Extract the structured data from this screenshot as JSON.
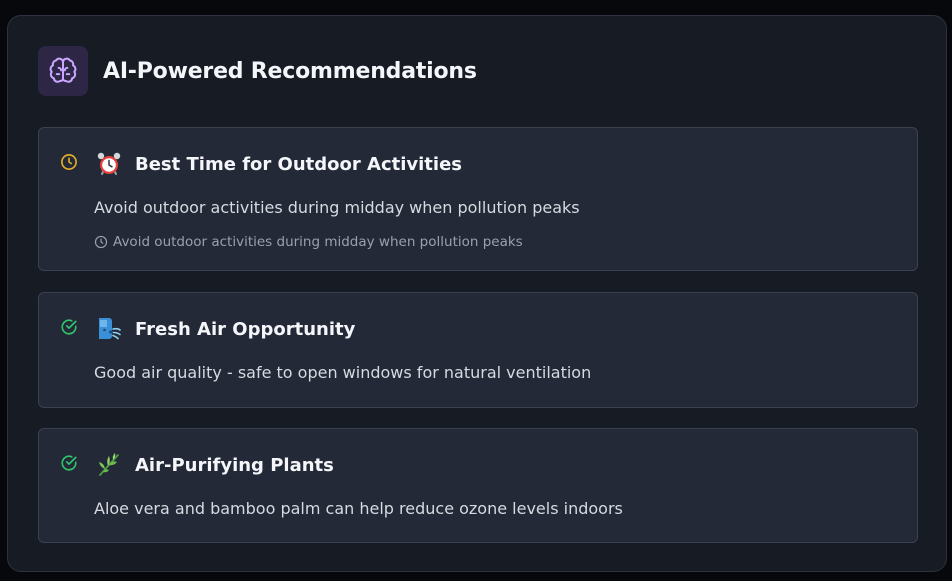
{
  "header": {
    "title": "AI-Powered Recommendations",
    "icon": "brain-icon",
    "icon_color": "#c9a6ff"
  },
  "recommendations": [
    {
      "status_icon": "clock-icon",
      "status_color": "#e2ad2a",
      "emoji": "⏰",
      "title": "Best Time for Outdoor Activities",
      "description": "Avoid outdoor activities during midday when pollution peaks",
      "note": "Avoid outdoor activities during midday when pollution peaks"
    },
    {
      "status_icon": "check-circle-icon",
      "status_color": "#2fc46e",
      "emoji": "🌬️",
      "title": "Fresh Air Opportunity",
      "description": "Good air quality - safe to open windows for natural ventilation"
    },
    {
      "status_icon": "check-circle-icon",
      "status_color": "#2fc46e",
      "emoji": "🌿",
      "title": "Air-Purifying Plants",
      "description": "Aloe vera and bamboo palm can help reduce ozone levels indoors"
    }
  ]
}
